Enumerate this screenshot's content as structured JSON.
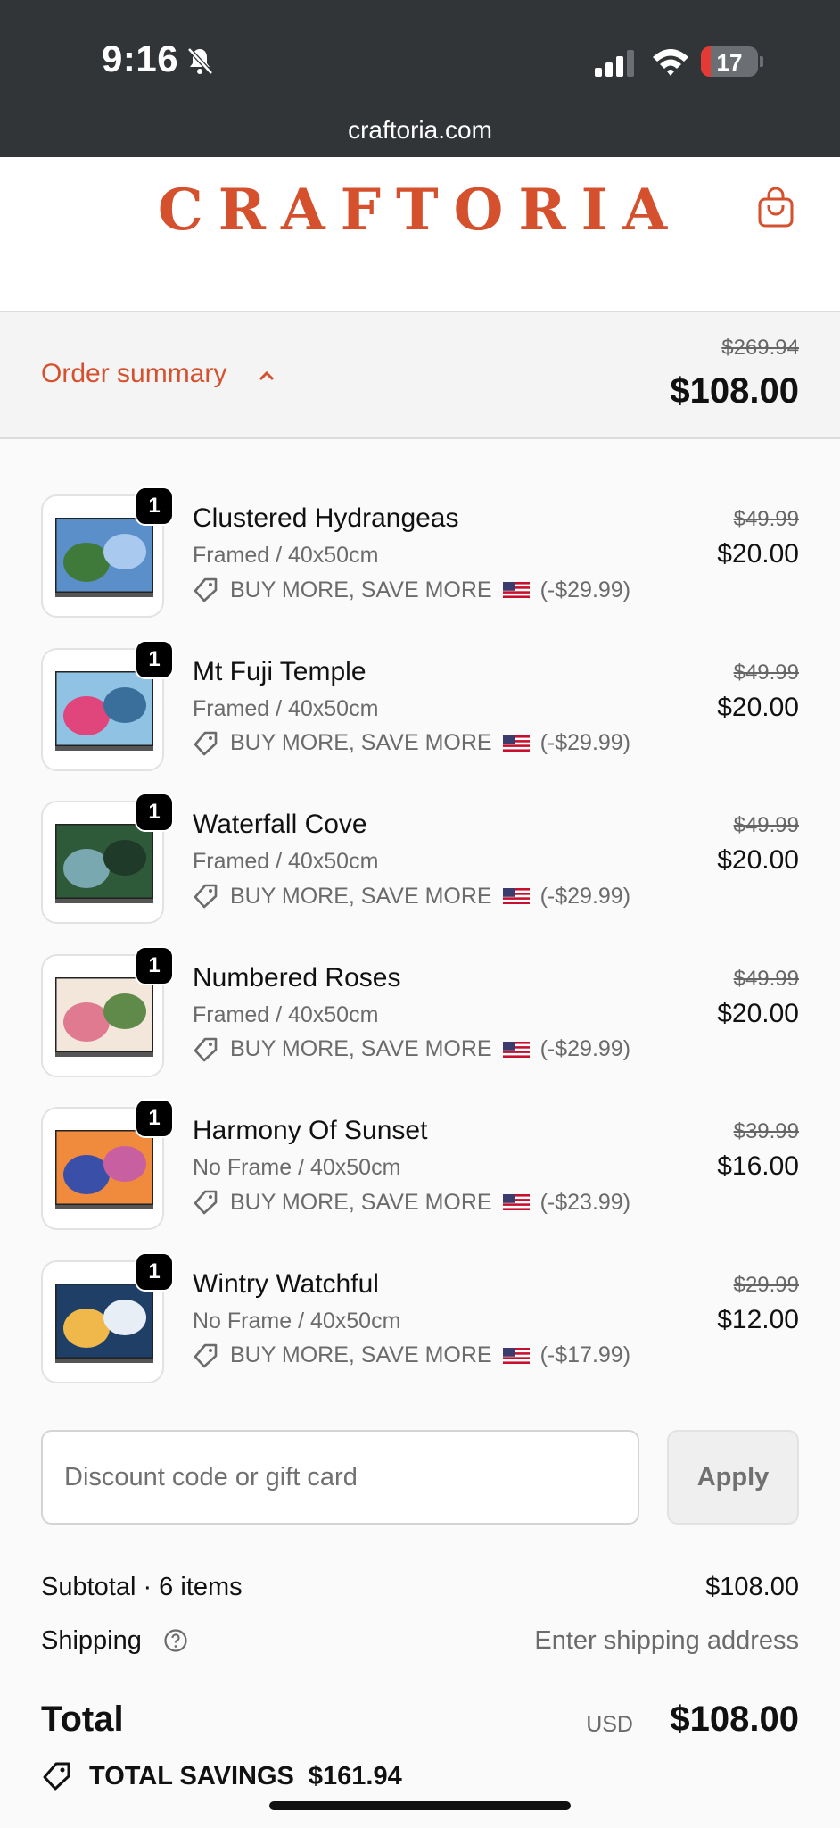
{
  "status_bar": {
    "time": "9:16",
    "battery": "17",
    "battery_level": 0.17
  },
  "browser": {
    "url": "craftoria.com"
  },
  "header": {
    "logo": "CRAFTORIA"
  },
  "summary": {
    "label": "Order summary",
    "original_total": "$269.94",
    "total": "$108.00"
  },
  "items": [
    {
      "qty": "1",
      "name": "Clustered Hydrangeas",
      "variant": "Framed / 40x50cm",
      "discount": "BUY MORE, SAVE MORE",
      "discount_amount": "(-$29.99)",
      "original_price": "$49.99",
      "price": "$20.00",
      "colors": [
        "#5b8fc9",
        "#3f7a3a",
        "#a9c9ee"
      ]
    },
    {
      "qty": "1",
      "name": "Mt Fuji Temple",
      "variant": "Framed / 40x50cm",
      "discount": "BUY MORE, SAVE MORE",
      "discount_amount": "(-$29.99)",
      "original_price": "$49.99",
      "price": "$20.00",
      "colors": [
        "#8fc2e3",
        "#e0457b",
        "#3a6f9c"
      ]
    },
    {
      "qty": "1",
      "name": "Waterfall Cove",
      "variant": "Framed / 40x50cm",
      "discount": "BUY MORE, SAVE MORE",
      "discount_amount": "(-$29.99)",
      "original_price": "$49.99",
      "price": "$20.00",
      "colors": [
        "#2e5a3a",
        "#7aa8b0",
        "#1f3a28"
      ]
    },
    {
      "qty": "1",
      "name": "Numbered Roses",
      "variant": "Framed / 40x50cm",
      "discount": "BUY MORE, SAVE MORE",
      "discount_amount": "(-$29.99)",
      "original_price": "$49.99",
      "price": "$20.00",
      "colors": [
        "#f3e7dc",
        "#e07a90",
        "#5f8a4a"
      ]
    },
    {
      "qty": "1",
      "name": "Harmony Of Sunset",
      "variant": "No Frame / 40x50cm",
      "discount": "BUY MORE, SAVE MORE",
      "discount_amount": "(-$23.99)",
      "original_price": "$39.99",
      "price": "$16.00",
      "colors": [
        "#f08a3c",
        "#3a4fa8",
        "#c85fa0"
      ]
    },
    {
      "qty": "1",
      "name": "Wintry Watchful",
      "variant": "No Frame / 40x50cm",
      "discount": "BUY MORE, SAVE MORE",
      "discount_amount": "(-$17.99)",
      "original_price": "$29.99",
      "price": "$12.00",
      "colors": [
        "#1f3f66",
        "#f0b84a",
        "#e8eef5"
      ]
    }
  ],
  "discount": {
    "placeholder": "Discount code or gift card",
    "apply_label": "Apply"
  },
  "totals": {
    "subtotal_label": "Subtotal · 6 items",
    "subtotal": "$108.00",
    "shipping_label": "Shipping",
    "shipping_value": "Enter shipping address",
    "total_label": "Total",
    "currency": "USD",
    "total": "$108.00",
    "savings_label": "TOTAL SAVINGS",
    "savings_amount": "$161.94"
  },
  "theme": {
    "accent": "#d5502d",
    "status_bar_bg": "#323538"
  }
}
